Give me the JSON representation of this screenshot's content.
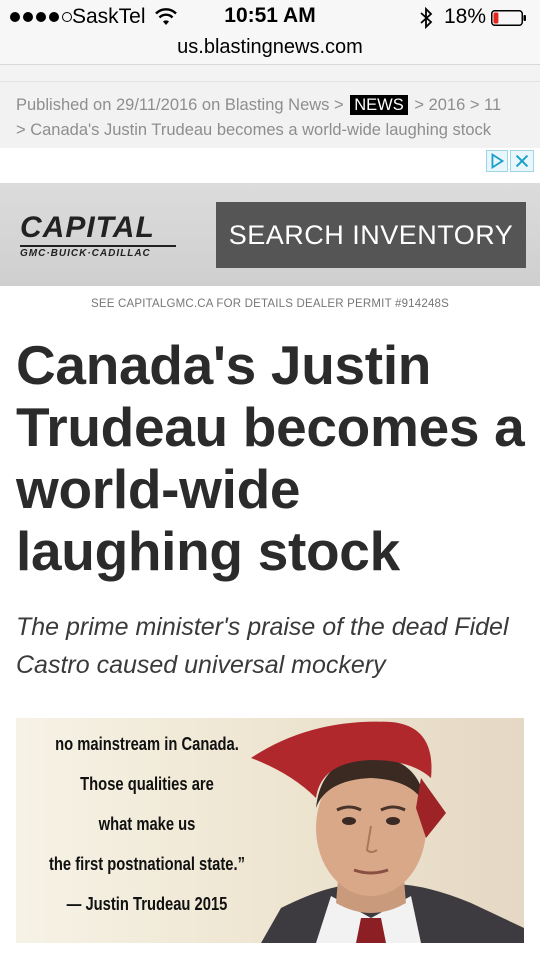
{
  "status_bar": {
    "carrier": "SaskTel",
    "time": "10:51 AM",
    "battery_percent": "18%",
    "battery_level": 0.18
  },
  "browser": {
    "url": "us.blastingnews.com"
  },
  "breadcrumb": {
    "published": "Published on 29/11/2016 on Blasting News >",
    "section": "NEWS",
    "path_rest": "> 2016 > 11",
    "article_crumb": "> Canada's Justin Trudeau becomes a world-wide laughing stock"
  },
  "ad": {
    "logo": "CAPITAL",
    "logo_sub": "GMC·BUICK·CADILLAC",
    "cta": "SEARCH INVENTORY",
    "disclaimer": "SEE CAPITALGMC.CA FOR DETAILS   DEALER PERMIT #914248S"
  },
  "article": {
    "title": "Canada's Justin Trudeau becomes a world-wide laughing stock",
    "subtitle": "The prime minister's praise of the dead Fidel Castro caused universal mockery"
  },
  "hero_image": {
    "quote_lines": [
      "no mainstream in Canada.",
      "Those qualities are",
      "what make us",
      "the first postnational state.”",
      "— Justin Trudeau 2015"
    ]
  }
}
